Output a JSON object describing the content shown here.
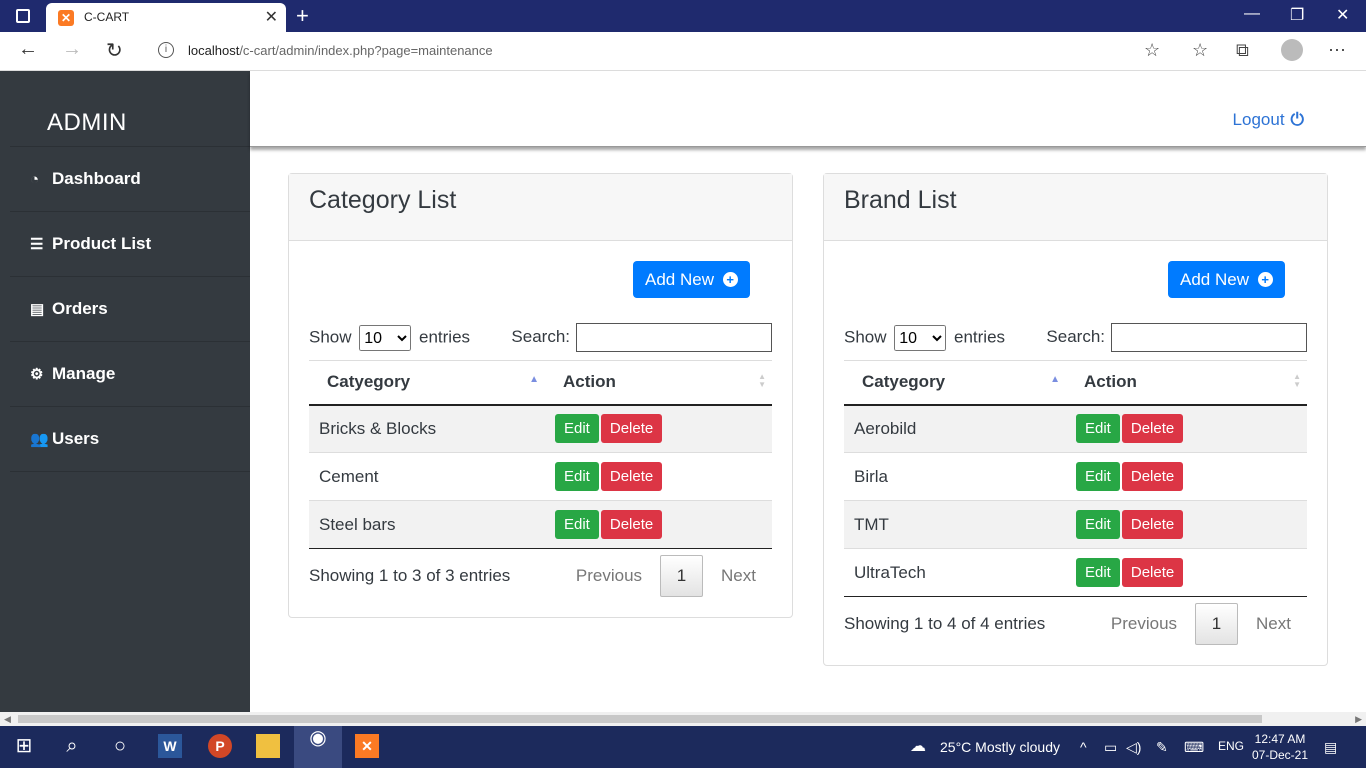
{
  "browser": {
    "tab_title": "C-CART",
    "url_host": "localhost",
    "url_path": "/c-cart/admin/index.php?page=maintenance"
  },
  "sidebar": {
    "brand": "ADMIN",
    "items": [
      {
        "label": "Dashboard",
        "icon": "dashboard-icon"
      },
      {
        "label": "Product List",
        "icon": "list-icon"
      },
      {
        "label": "Orders",
        "icon": "receipt-icon"
      },
      {
        "label": "Manage",
        "icon": "cogs-icon"
      },
      {
        "label": "Users",
        "icon": "users-icon"
      }
    ]
  },
  "topbar": {
    "logout_label": "Logout"
  },
  "category_card": {
    "title": "Category List",
    "add_label": "Add New",
    "show_label": "Show",
    "entries_value": "10",
    "entries_label": "entries",
    "search_label": "Search:",
    "col_name": "Catyegory",
    "col_action": "Action",
    "rows": [
      {
        "name": "Bricks & Blocks",
        "edit": "Edit",
        "delete": "Delete"
      },
      {
        "name": "Cement",
        "edit": "Edit",
        "delete": "Delete"
      },
      {
        "name": "Steel bars",
        "edit": "Edit",
        "delete": "Delete"
      }
    ],
    "info": "Showing 1 to 3 of 3 entries",
    "prev": "Previous",
    "page": "1",
    "next": "Next"
  },
  "brand_card": {
    "title": "Brand List",
    "add_label": "Add New",
    "show_label": "Show",
    "entries_value": "10",
    "entries_label": "entries",
    "search_label": "Search:",
    "col_name": "Catyegory",
    "col_action": "Action",
    "rows": [
      {
        "name": "Aerobild",
        "edit": "Edit",
        "delete": "Delete"
      },
      {
        "name": "Birla",
        "edit": "Edit",
        "delete": "Delete"
      },
      {
        "name": "TMT",
        "edit": "Edit",
        "delete": "Delete"
      },
      {
        "name": "UltraTech",
        "edit": "Edit",
        "delete": "Delete"
      }
    ],
    "info": "Showing 1 to 4 of 4 entries",
    "prev": "Previous",
    "page": "1",
    "next": "Next"
  },
  "taskbar": {
    "weather": "25°C  Mostly cloudy",
    "lang": "ENG",
    "time": "12:47 AM",
    "date": "07-Dec-21"
  },
  "colors": {
    "sidebar_bg": "#343a40",
    "primary": "#007bff",
    "success": "#28a745",
    "danger": "#dc3545",
    "logout": "#2d73d5"
  }
}
